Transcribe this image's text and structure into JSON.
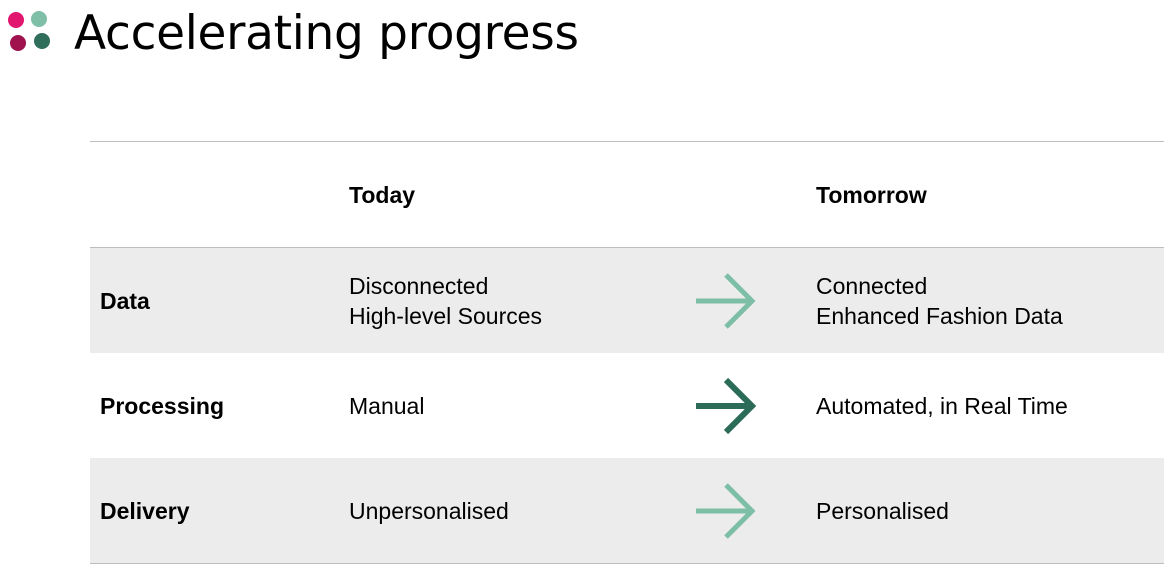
{
  "title": "Accelerating progress",
  "colors": {
    "dot_top_left": "#e0166f",
    "dot_top_right": "#7fbfa8",
    "dot_bottom_left": "#a0124e",
    "dot_bottom_right": "#2e6e5b",
    "arrow_light": "#7cbfa6",
    "arrow_dark": "#2b6b58",
    "row_shade": "#ececec"
  },
  "table": {
    "headers": {
      "today": "Today",
      "tomorrow": "Tomorrow"
    },
    "rows": [
      {
        "label": "Data",
        "today_line1": "Disconnected",
        "today_line2": "High-level Sources",
        "arrow_icon": "arrow-right-icon",
        "arrow_style": "light",
        "tomorrow_line1": "Connected",
        "tomorrow_line2": "Enhanced Fashion Data"
      },
      {
        "label": "Processing",
        "today_line1": "Manual",
        "arrow_icon": "arrow-right-icon",
        "arrow_style": "dark",
        "tomorrow_line1": "Automated, in Real Time"
      },
      {
        "label": "Delivery",
        "today_line1": "Unpersonalised",
        "arrow_icon": "arrow-right-icon",
        "arrow_style": "light",
        "tomorrow_line1": "Personalised"
      }
    ]
  }
}
